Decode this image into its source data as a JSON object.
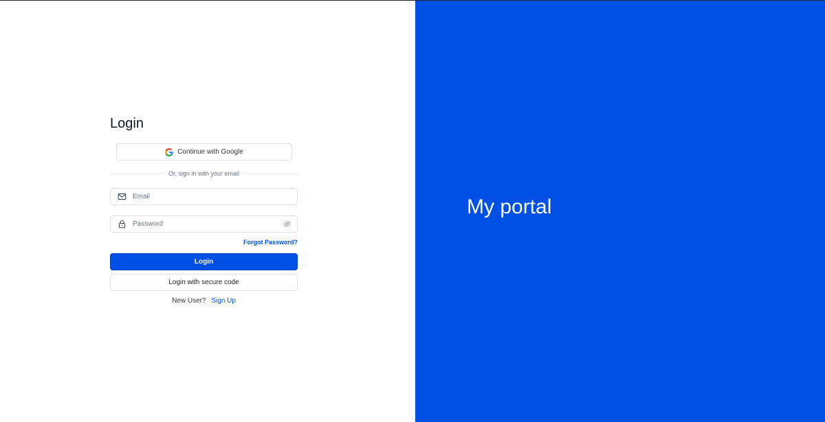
{
  "login": {
    "title": "Login",
    "google_button_label": "Continue with Google",
    "divider_text": "Or, sign in with your email",
    "email": {
      "value": "",
      "placeholder": "Email"
    },
    "password": {
      "value": "",
      "placeholder": "Password"
    },
    "forgot_password_label": "Forgot Password?",
    "login_button_label": "Login",
    "secure_code_button_label": "Login with secure code",
    "new_user_text": "New User?",
    "signup_link_label": "Sign Up"
  },
  "brand": {
    "title": "My portal"
  },
  "colors": {
    "accent": "#0050e6",
    "panel_background": "#0050e6",
    "page_background": "#ffffff",
    "border": "#dcdfe4"
  },
  "icons": {
    "google": "google-icon",
    "email": "mail-icon",
    "password": "lock-icon",
    "toggle_visibility": "eye-off-icon"
  }
}
